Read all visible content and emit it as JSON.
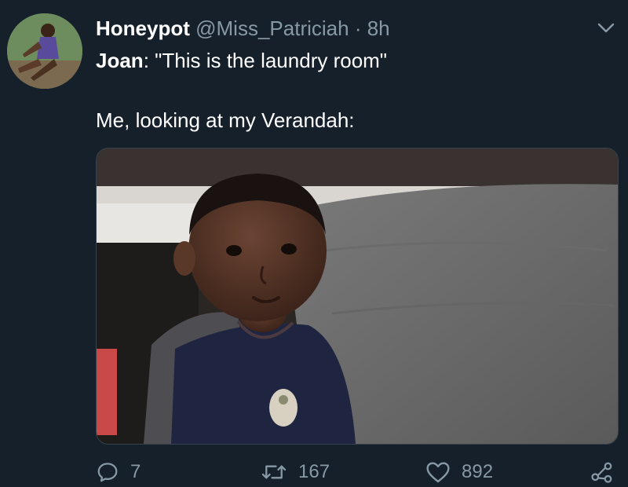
{
  "tweet": {
    "display_name": "Honeypot",
    "handle": "@Miss_Patriciah",
    "separator": "·",
    "time": "8h",
    "line1_speaker": "Joan",
    "line1_text": ": \"This is the laundry room\"",
    "line2_text": "Me, looking at my Verandah:"
  },
  "actions": {
    "replies": "7",
    "retweets": "167",
    "likes": "892"
  },
  "icons": {
    "reply": "reply-icon",
    "retweet": "retweet-icon",
    "like": "heart-icon",
    "share": "share-icon",
    "menu": "chevron-down-icon"
  },
  "colors": {
    "background": "#15202b",
    "secondary_text": "#8899a6",
    "primary_text": "#ffffff",
    "border": "#38444d"
  }
}
